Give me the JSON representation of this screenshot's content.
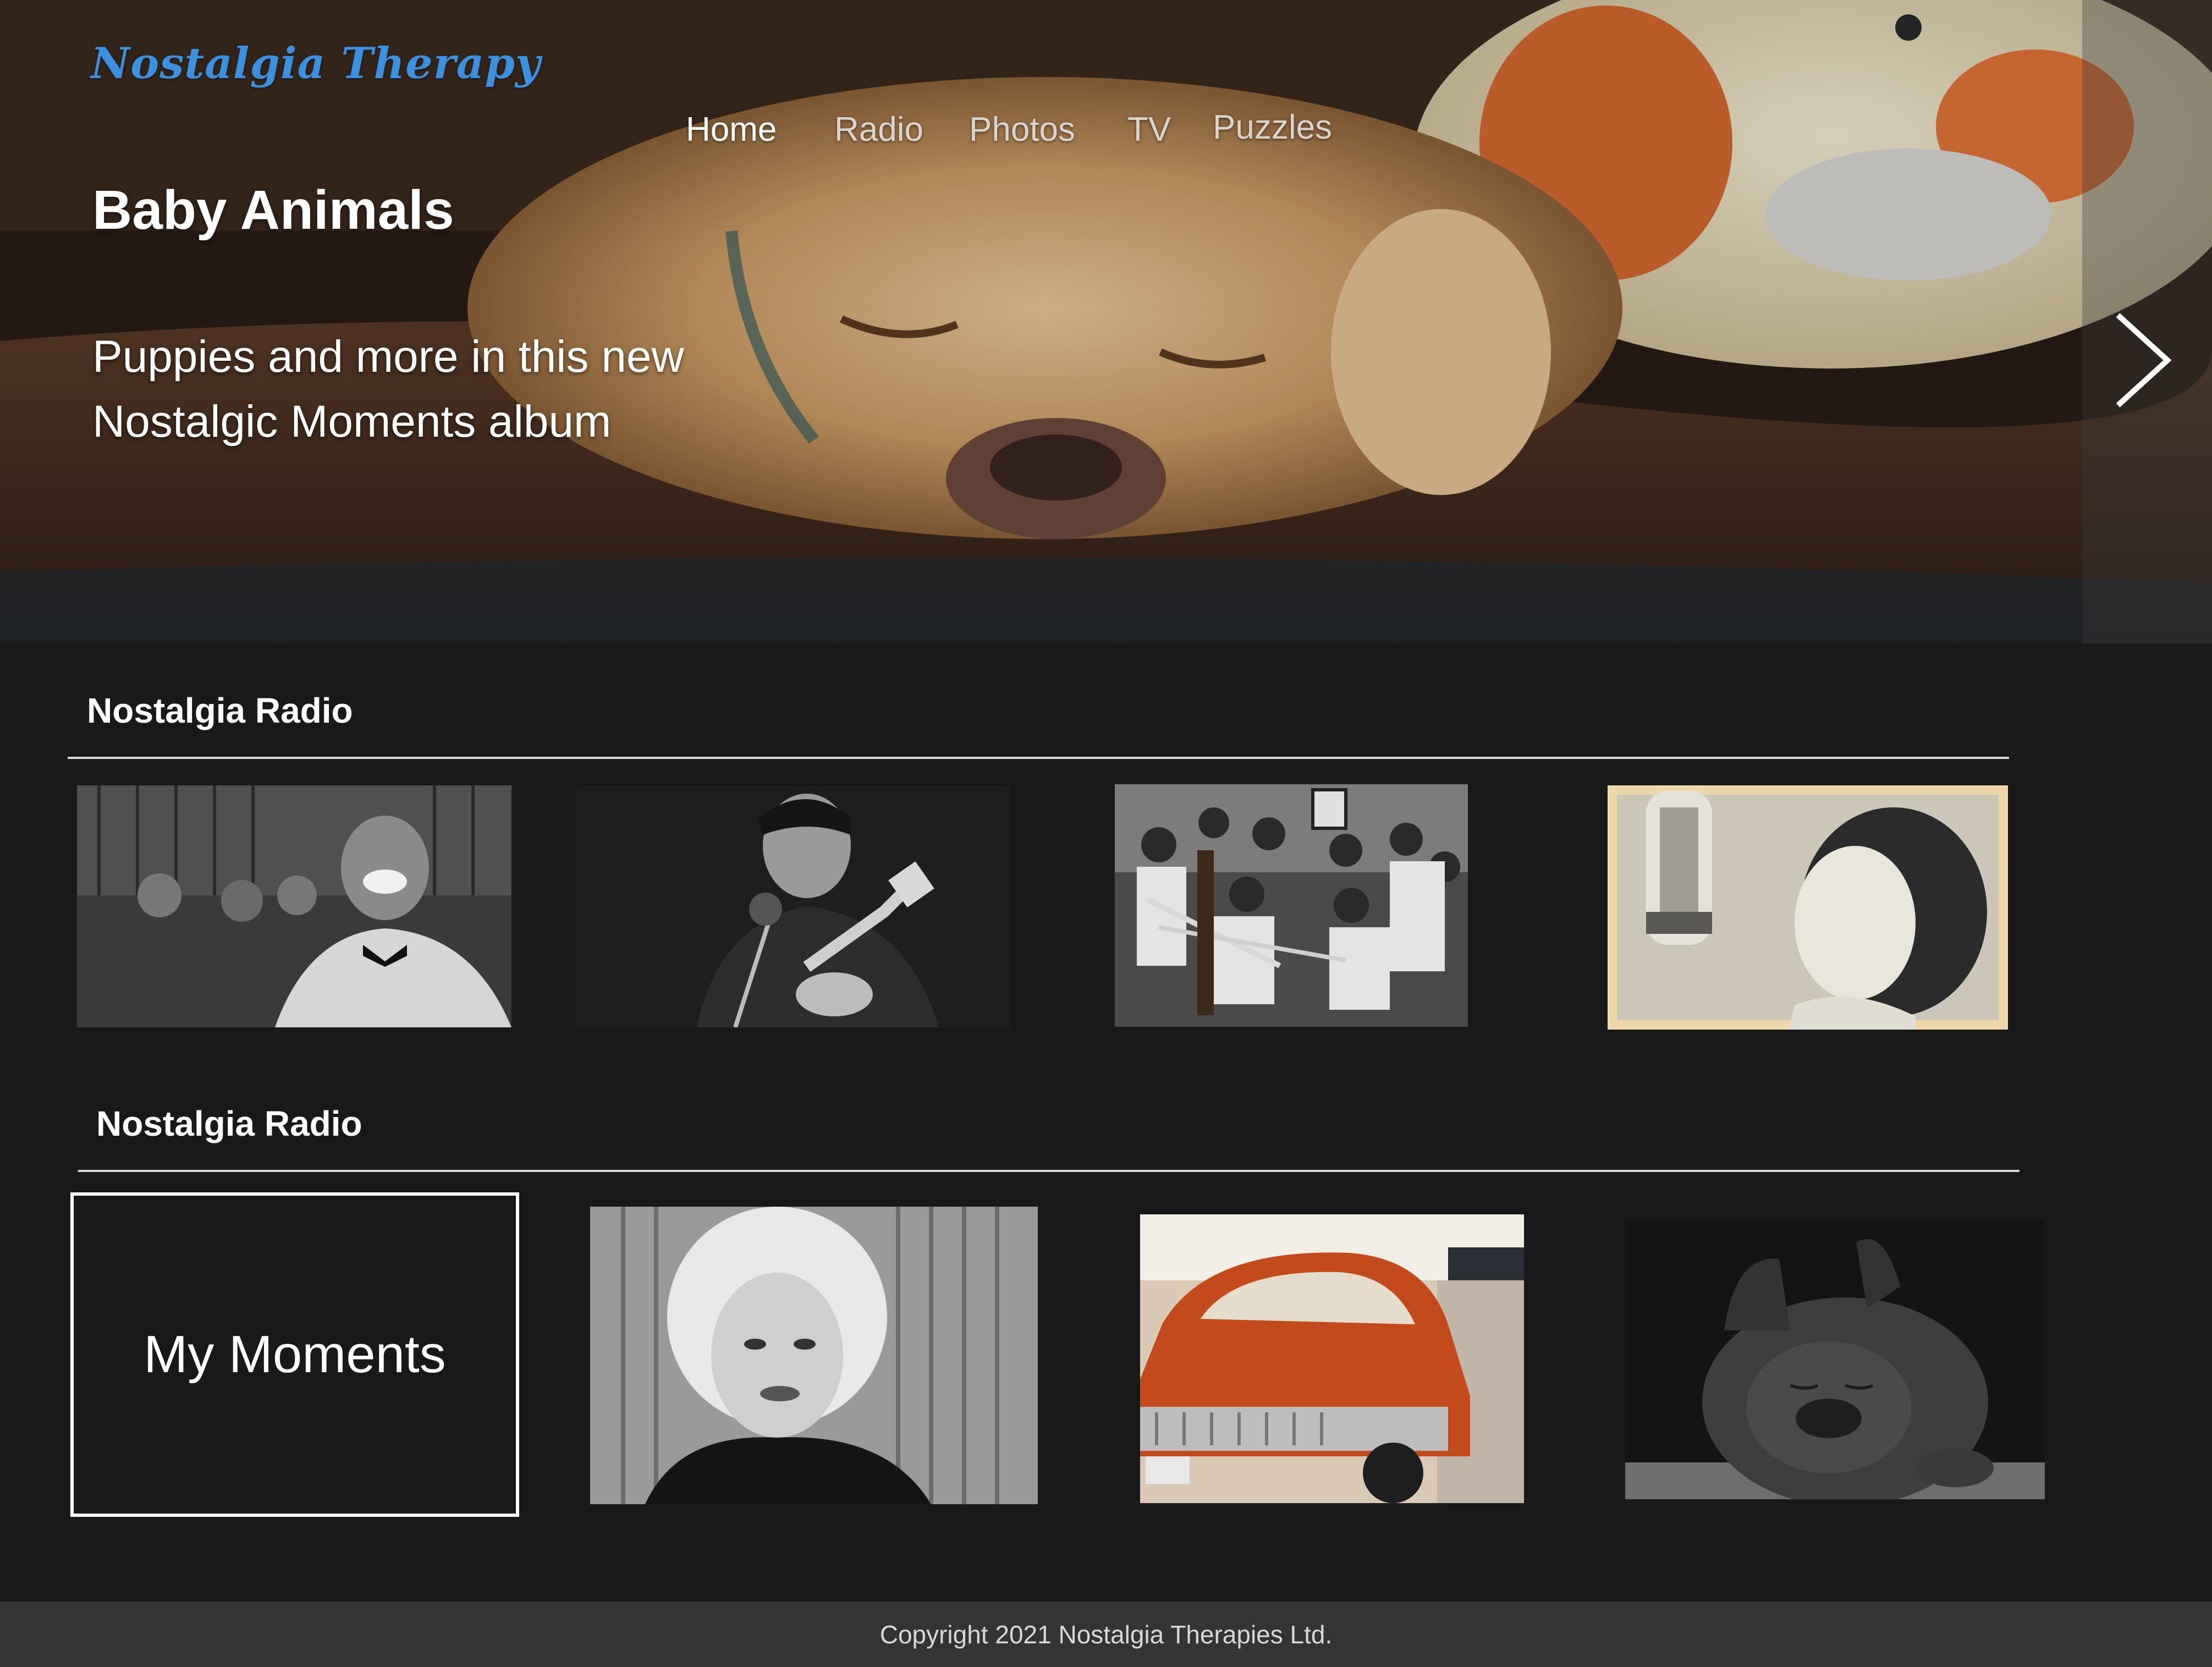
{
  "brand": {
    "name": "Nostalgia Therapy",
    "color": "#3d8fe0"
  },
  "nav": {
    "items": [
      {
        "label": "Home",
        "active": true
      },
      {
        "label": "Radio",
        "active": false
      },
      {
        "label": "Photos",
        "active": false
      },
      {
        "label": "TV",
        "active": false
      },
      {
        "label": "Puzzles",
        "active": false
      }
    ]
  },
  "hero": {
    "title": "Baby Animals",
    "subtitle_line1": "Puppies and more in this new",
    "subtitle_line2": "Nostalgic Moments album",
    "next_icon": "chevron-right-icon"
  },
  "sections": [
    {
      "title": "Nostalgia Radio",
      "thumbnails": [
        "singer-smiling-bw",
        "guitarist-microphone-bw",
        "jazz-band-bw",
        "woman-microphone-sepia"
      ]
    },
    {
      "title": "Nostalgia Radio",
      "feature_tile": "My Moments",
      "thumbnails": [
        "woman-portrait-bw",
        "vintage-orange-car",
        "sleeping-bulldog"
      ]
    }
  ],
  "footer": {
    "copyright": "Copyright 2021 Nostalgia Therapies Ltd."
  }
}
